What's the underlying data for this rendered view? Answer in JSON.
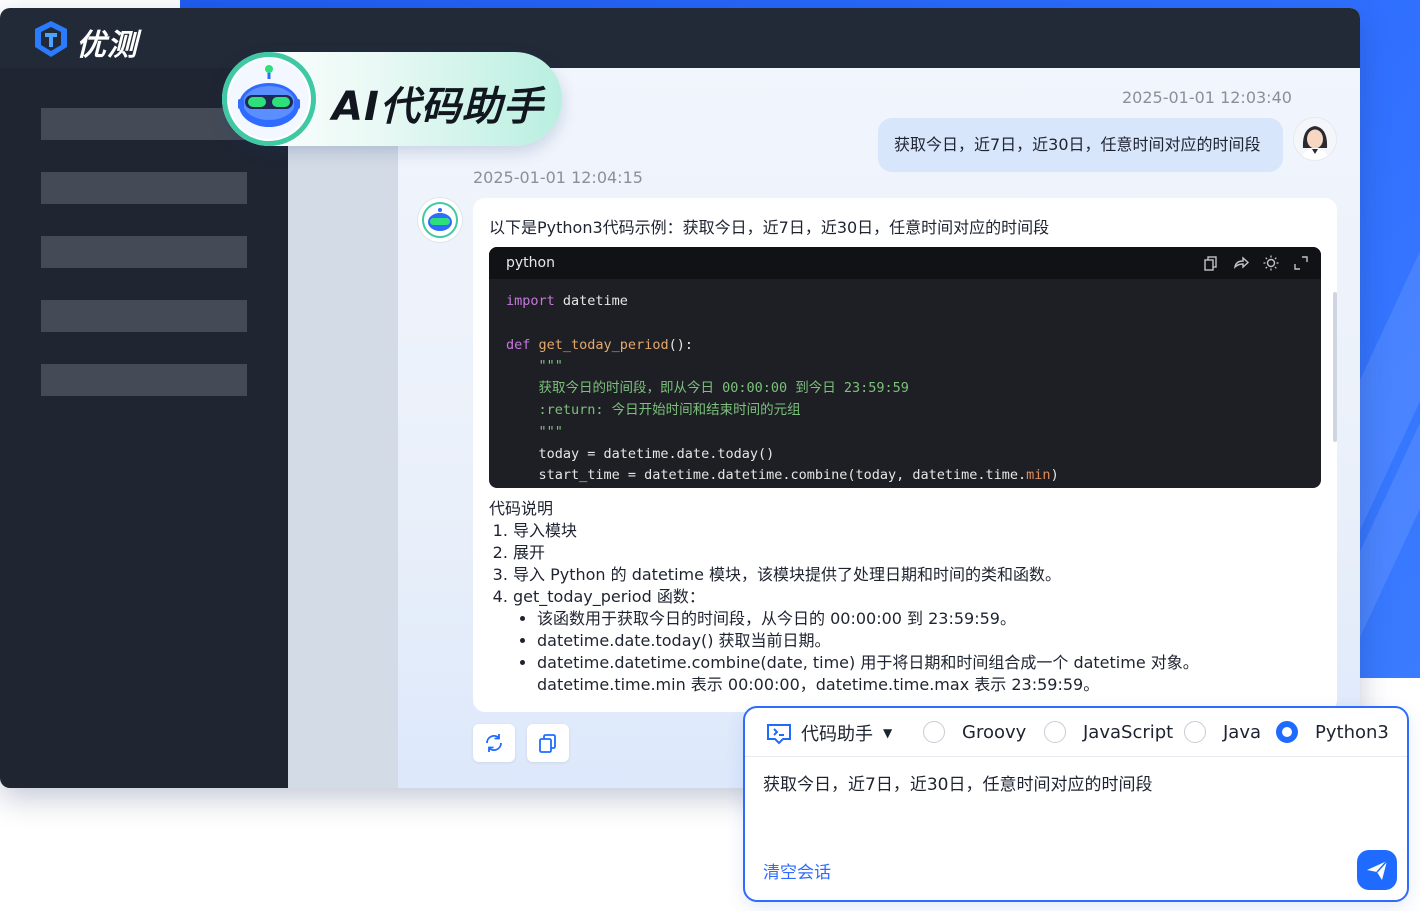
{
  "app": {
    "brand": "优测"
  },
  "badge": {
    "title": "AI代码助手"
  },
  "conversation": {
    "user_message": {
      "timestamp": "2025-01-01 12:03:40",
      "text": "获取今日，近7日，近30日，任意时间对应的时间段"
    },
    "bot_message": {
      "timestamp": "2025-01-01 12:04:15",
      "intro": "以下是Python3代码示例：获取今日，近7日，近30日，任意时间对应的时间段",
      "code": {
        "language": "python",
        "lines": [
          "import datetime",
          "",
          "def get_today_period():",
          "    \"\"\"",
          "    获取今日的时间段，即从今日 00:00:00 到今日 23:59:59",
          "    :return: 今日开始时间和结束时间的元组",
          "    \"\"\"",
          "    today = datetime.date.today()",
          "    start_time = datetime.datetime.combine(today, datetime.time.min)"
        ]
      },
      "explanation": {
        "title": "代码说明",
        "items": [
          "导入模块",
          "展开",
          "导入 Python 的 datetime 模块，该模块提供了处理日期和时间的类和函数。",
          "get_today_period 函数："
        ],
        "sub_items": [
          "该函数用于获取今日的时间段，从今日的 00:00:00 到 23:59:59。",
          "datetime.date.today() 获取当前日期。",
          "datetime.datetime.combine(date, time) 用于将日期和时间组合成一个 datetime 对象。",
          "datetime.time.min 表示 00:00:00，datetime.time.max 表示 23:59:59。"
        ]
      }
    }
  },
  "input_panel": {
    "mode": "代码助手",
    "languages": [
      "Groovy",
      "JavaScript",
      "Java",
      "Python3"
    ],
    "selected_language": "Python3",
    "input_text": "获取今日，近7日，近30日，任意时间对应的时间段",
    "clear_label": "清空会话"
  },
  "icons": {
    "code_tools": [
      "copy-icon",
      "share-icon",
      "theme-icon",
      "fullscreen-icon"
    ],
    "actions": [
      "refresh-icon",
      "copy-icon"
    ],
    "send": "send-icon"
  },
  "colors": {
    "accent": "#1f6bff",
    "sidebar": "#1f2531",
    "topbar": "#222a38",
    "code_bg": "#1e1f24"
  }
}
